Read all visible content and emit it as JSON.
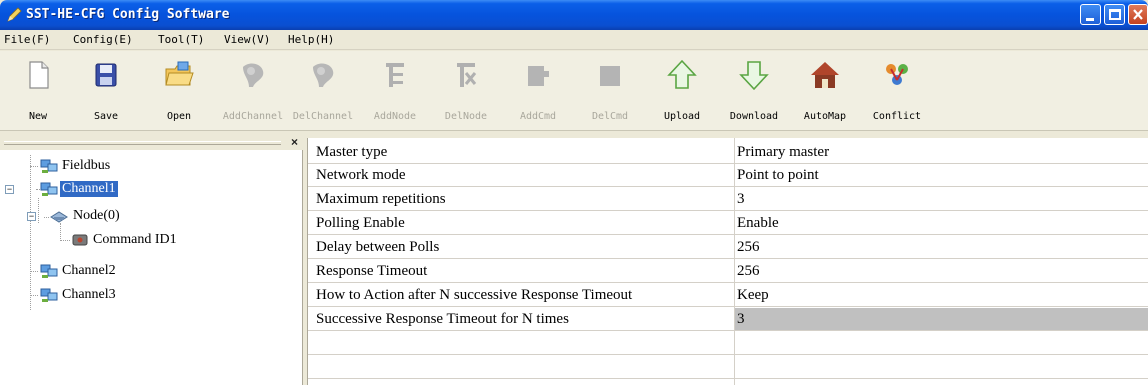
{
  "window": {
    "title": "SST-HE-CFG Config Software"
  },
  "menu": [
    {
      "label": "File(F)"
    },
    {
      "label": "Config(E)"
    },
    {
      "label": "Tool(T)"
    },
    {
      "label": "View(V)"
    },
    {
      "label": "Help(H)"
    }
  ],
  "toolbar": [
    {
      "label": "New",
      "icon": "new-file-icon",
      "enabled": true
    },
    {
      "label": "Save",
      "icon": "save-icon",
      "enabled": true
    },
    {
      "label": "Open",
      "icon": "open-folder-icon",
      "enabled": true
    },
    {
      "label": "AddChannel",
      "icon": "add-channel-icon",
      "enabled": false
    },
    {
      "label": "DelChannel",
      "icon": "del-channel-icon",
      "enabled": false
    },
    {
      "label": "AddNode",
      "icon": "add-node-icon",
      "enabled": false
    },
    {
      "label": "DelNode",
      "icon": "del-node-icon",
      "enabled": false
    },
    {
      "label": "AddCmd",
      "icon": "add-cmd-icon",
      "enabled": false
    },
    {
      "label": "DelCmd",
      "icon": "del-cmd-icon",
      "enabled": false
    },
    {
      "label": "Upload",
      "icon": "upload-icon",
      "enabled": true
    },
    {
      "label": "Download",
      "icon": "download-icon",
      "enabled": true
    },
    {
      "label": "AutoMap",
      "icon": "automap-icon",
      "enabled": true
    },
    {
      "label": "Conflict",
      "icon": "conflict-icon",
      "enabled": true
    }
  ],
  "tree": {
    "items": [
      {
        "label": "Fieldbus",
        "icon": "network-icon",
        "selected": false
      },
      {
        "label": "Channel1",
        "icon": "network-icon",
        "selected": true
      },
      {
        "label": "Node(0)",
        "icon": "node-icon",
        "selected": false
      },
      {
        "label": "Command ID1",
        "icon": "command-icon",
        "selected": false
      },
      {
        "label": "Channel2",
        "icon": "network-icon",
        "selected": false
      },
      {
        "label": "Channel3",
        "icon": "network-icon",
        "selected": false
      }
    ]
  },
  "properties": [
    {
      "key": "Master type",
      "value": "Primary master"
    },
    {
      "key": "Network mode",
      "value": "Point to point"
    },
    {
      "key": "Maximum repetitions",
      "value": "3"
    },
    {
      "key": "Polling Enable",
      "value": "Enable"
    },
    {
      "key": "Delay between Polls",
      "value": "256"
    },
    {
      "key": "Response Timeout",
      "value": "256"
    },
    {
      "key": "How to Action after N successive Response Timeout",
      "value": "Keep"
    },
    {
      "key": "Successive Response Timeout for N times",
      "value": "3",
      "highlighted": true
    },
    {
      "key": "",
      "value": ""
    },
    {
      "key": "",
      "value": ""
    }
  ]
}
